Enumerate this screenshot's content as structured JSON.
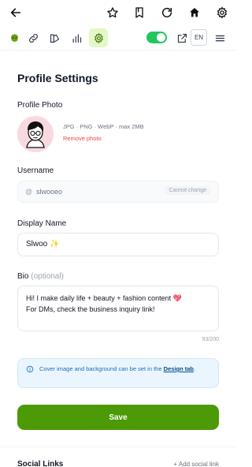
{
  "toolbar": {
    "lang": "EN"
  },
  "page": {
    "title": "Profile Settings"
  },
  "photo": {
    "label": "Profile Photo",
    "hint": "JPG · PNG · WebP · max 2MB",
    "remove": "Remove photo"
  },
  "username": {
    "label": "Username",
    "prefix": "@",
    "value": "slwooeo",
    "lock_note": "Cannot change"
  },
  "display_name": {
    "label": "Display Name",
    "value": "Slwoo ✨"
  },
  "bio": {
    "label": "Bio",
    "optional": "(optional)",
    "lines": [
      "Hi! I make daily life + beauty + fashion content 💖",
      "For DMs, check the business inquiry link!"
    ],
    "counter": "93/200"
  },
  "info": {
    "text": "Cover image and background can be set in the",
    "link": "Design tab",
    "suffix": "."
  },
  "actions": {
    "save": "Save"
  },
  "social": {
    "title": "Social Links",
    "add": "+ Add social link"
  },
  "colors": {
    "accent": "#4c9a06",
    "toggle": "#22c55e",
    "info_bg": "#eaf5fe"
  },
  "icons": [
    "back-arrow-icon",
    "star-icon",
    "bookmark-icon",
    "refresh-icon",
    "home-icon",
    "settings-gear-icon",
    "blob-icon",
    "link-icon",
    "palette-icon",
    "bar-chart-icon",
    "gear-icon",
    "external-link-icon",
    "menu-icon",
    "info-icon"
  ]
}
